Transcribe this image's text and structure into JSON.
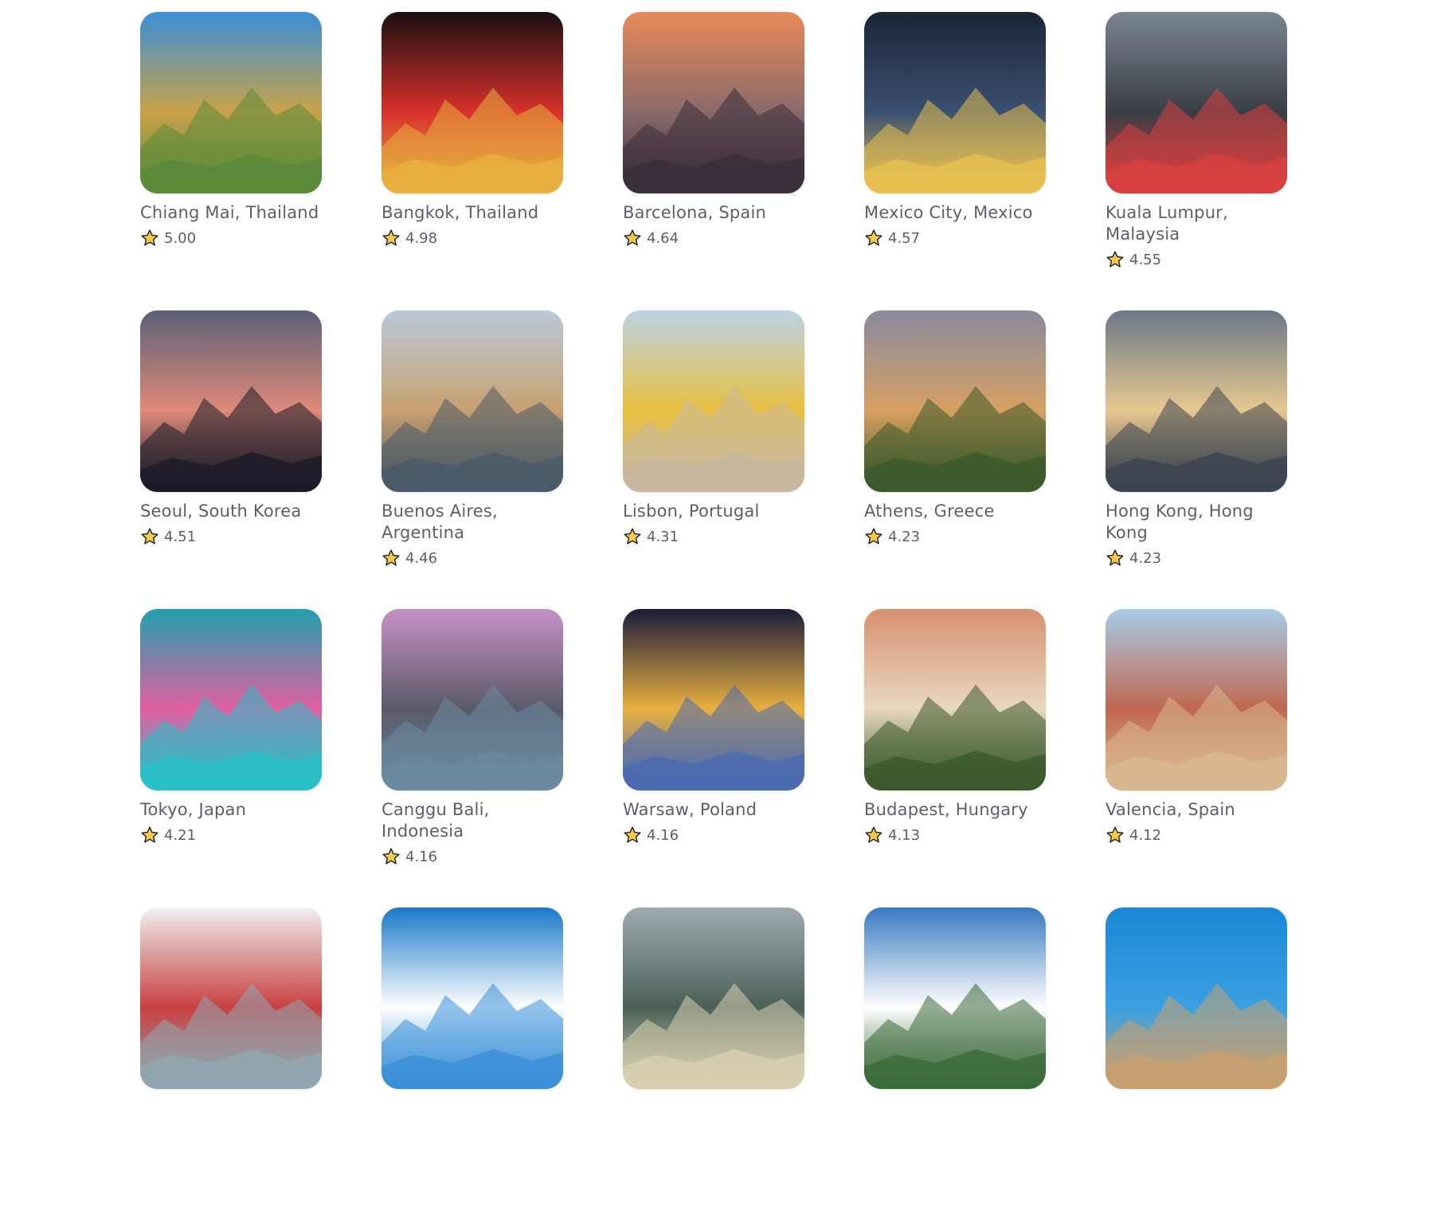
{
  "cities": [
    {
      "name": "Chiang Mai, Thailand",
      "rating": "5.00",
      "image_icon": "temple-photo",
      "colors": [
        "#3a8fd8",
        "#c9a24a",
        "#5a8a3a"
      ]
    },
    {
      "name": "Bangkok, Thailand",
      "rating": "4.98",
      "image_icon": "night-street-photo",
      "colors": [
        "#1a0f12",
        "#d8302a",
        "#e8b040"
      ]
    },
    {
      "name": "Barcelona, Spain",
      "rating": "4.64",
      "image_icon": "cityscape-photo",
      "colors": [
        "#e88a5a",
        "#8a6a6a",
        "#3a2e3a"
      ]
    },
    {
      "name": "Mexico City, Mexico",
      "rating": "4.57",
      "image_icon": "night-aerial-photo",
      "colors": [
        "#1a2438",
        "#3a5070",
        "#e8c050"
      ]
    },
    {
      "name": "Kuala Lumpur, Malaysia",
      "rating": "4.55",
      "image_icon": "street-crossing-photo",
      "colors": [
        "#7a8590",
        "#3a3e44",
        "#d84040"
      ]
    },
    {
      "name": "Seoul, South Korea",
      "rating": "4.51",
      "image_icon": "dusk-skyline-photo",
      "colors": [
        "#5a6078",
        "#e08a7a",
        "#1a1c28"
      ]
    },
    {
      "name": "Buenos Aires, Argentina",
      "rating": "4.46",
      "image_icon": "waterfront-towers-photo",
      "colors": [
        "#b8cad8",
        "#c8a070",
        "#4a5a68"
      ]
    },
    {
      "name": "Lisbon, Portugal",
      "rating": "4.31",
      "image_icon": "tram-street-photo",
      "colors": [
        "#bcd2e4",
        "#e8c040",
        "#c8b8a0"
      ]
    },
    {
      "name": "Athens, Greece",
      "rating": "4.23",
      "image_icon": "acropolis-photo",
      "colors": [
        "#8a8aa0",
        "#d8a060",
        "#3a5a2a"
      ]
    },
    {
      "name": "Hong Kong, Hong Kong",
      "rating": "4.23",
      "image_icon": "harbour-skyline-photo",
      "colors": [
        "#6a7888",
        "#e8c890",
        "#3a4450"
      ]
    },
    {
      "name": "Tokyo, Japan",
      "rating": "4.21",
      "image_icon": "neon-street-photo",
      "colors": [
        "#20a0b0",
        "#e060a0",
        "#28c0c8"
      ]
    },
    {
      "name": "Canggu Bali, Indonesia",
      "rating": "4.16",
      "image_icon": "beach-club-photo",
      "colors": [
        "#c890c8",
        "#5a5a68",
        "#6a8aa0"
      ]
    },
    {
      "name": "Warsaw, Poland",
      "rating": "4.16",
      "image_icon": "palace-night-photo",
      "colors": [
        "#1a1a3a",
        "#e8b040",
        "#4a6ab0"
      ]
    },
    {
      "name": "Budapest, Hungary",
      "rating": "4.13",
      "image_icon": "parliament-photo",
      "colors": [
        "#d89070",
        "#e8d8c0",
        "#3a5a2a"
      ]
    },
    {
      "name": "Valencia, Spain",
      "rating": "4.12",
      "image_icon": "plaza-photo",
      "colors": [
        "#a8cce8",
        "#c06850",
        "#d8b890"
      ]
    },
    {
      "name": "",
      "rating": "",
      "image_icon": "street-photo",
      "colors": [
        "#f0f0f0",
        "#c84040",
        "#90a8b0"
      ]
    },
    {
      "name": "",
      "rating": "",
      "image_icon": "sky-photo",
      "colors": [
        "#1a78c8",
        "#ffffff",
        "#3a90d8"
      ]
    },
    {
      "name": "",
      "rating": "",
      "image_icon": "dome-photo",
      "colors": [
        "#a0aab0",
        "#4a6058",
        "#d8d0b0"
      ]
    },
    {
      "name": "",
      "rating": "",
      "image_icon": "palm-tower-photo",
      "colors": [
        "#3a78c0",
        "#ffffff",
        "#3a6a3a"
      ]
    },
    {
      "name": "",
      "rating": "",
      "image_icon": "hillside-photo",
      "colors": [
        "#1a88d8",
        "#3aa0e0",
        "#c8a070"
      ]
    }
  ],
  "ui": {
    "star_icon": "star-icon",
    "star_color": "#f7c948",
    "star_outline": "#1d1d1d",
    "text_color": "#5b5f66"
  }
}
